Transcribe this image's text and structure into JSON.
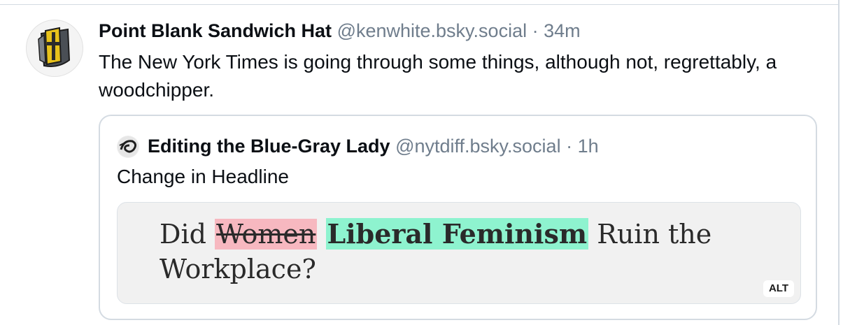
{
  "post": {
    "author_name": "Point Blank Sandwich Hat",
    "handle": "@kenwhite.bsky.social",
    "separator": " · ",
    "time": "34m",
    "text": "The New York Times is going through some things, although not, regrettably, a woodchipper.",
    "avatar_icon": "shield-cross-icon"
  },
  "quote": {
    "author_name": "Editing the Blue-Gray Lady",
    "handle": "@nytdiff.bsky.social",
    "separator": " · ",
    "time": "1h",
    "text": "Change in Headline",
    "avatar_icon": "spiral-logo-icon",
    "image": {
      "prefix": "Did",
      "deleted": "Women",
      "inserted": "Liberal Feminism",
      "suffix": "Ruin the Workplace?",
      "alt_label": "ALT"
    }
  },
  "colors": {
    "deleted_highlight": "#f7b8c0",
    "inserted_highlight": "#8ef3cf",
    "muted_text": "#6f7d8c",
    "border": "#d4dbe2"
  }
}
